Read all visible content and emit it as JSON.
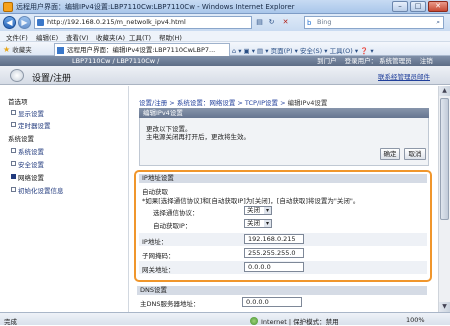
{
  "window": {
    "title": "远程用户界面：编辑IPv4设置:LBP7110Cw:LBP7110Cw - Windows Internet Explorer",
    "min": "–",
    "max": "□",
    "close": "✕"
  },
  "address": {
    "url": "http://192.168.0.215/m_netwolk_ipv4.html",
    "search_placeholder": "Bing",
    "search_engine": "b"
  },
  "menu": [
    "文件(F)",
    "编辑(E)",
    "查看(V)",
    "收藏夹(A)",
    "工具(T)",
    "帮助(H)"
  ],
  "favorites": {
    "label": "收藏夹",
    "tab": "远程用户界面：编辑IPv4设置:LBP7110CwLBP7...",
    "tools": "⌂ ▾  ▣ ▾  ▤ ▾  页面(P) ▾  安全(S) ▾  工具(O) ▾  ❓ ▾"
  },
  "device": {
    "name": "LBP7110Cw / LBP7110Cw /",
    "links": [
      "到门户",
      "登录用户： 系统管理员",
      "注销"
    ],
    "page_title": "设置/注册",
    "fw_link": "联系经管理员邮件"
  },
  "sidebar": {
    "sections": [
      {
        "label": "首选项",
        "items": [
          {
            "label": "显示设置"
          },
          {
            "label": "定时器设置"
          }
        ]
      },
      {
        "label": "系统设置",
        "items": [
          {
            "label": "系统设置"
          },
          {
            "label": "安全设置"
          },
          {
            "label": "网络设置",
            "active": true
          },
          {
            "label": "初始化设置信息"
          }
        ]
      }
    ]
  },
  "breadcrumb": {
    "parts": [
      "设置/注册",
      "系统设置：网络设置",
      "TCP/IP设置"
    ],
    "sep": ">",
    "current": "编辑IPv4设置"
  },
  "edit": {
    "header": "编辑IPv4设置",
    "msg1": "更改以下设置。",
    "msg2": "主电源关闭再打开后，更改将生效。",
    "ok": "确定",
    "cancel": "取消"
  },
  "ip": {
    "header": "IP地址设置",
    "auto_label": "自动获取",
    "note": "*如果[选择通信协议]和[自动获取IP]为[关闭]，[自动获取]将设置为\"关闭\"。",
    "protocol_label": "选择通信协议：",
    "protocol_value": "关闭",
    "autoip_label": "自动获取IP：",
    "autoip_value": "关闭",
    "addr_label": "IP地址：",
    "addr_value": "192.168.0.215",
    "mask_label": "子网掩码：",
    "mask_value": "255.255.255.0",
    "gw_label": "网关地址：",
    "gw_value": "0.0.0.0"
  },
  "dns": {
    "header": "DNS设置",
    "primary_label": "主DNS服务器地址：",
    "primary_value": "0.0.0.0"
  },
  "status": {
    "text": "完成",
    "zone": "Internet | 保护模式：禁用",
    "zoom": "100%"
  }
}
